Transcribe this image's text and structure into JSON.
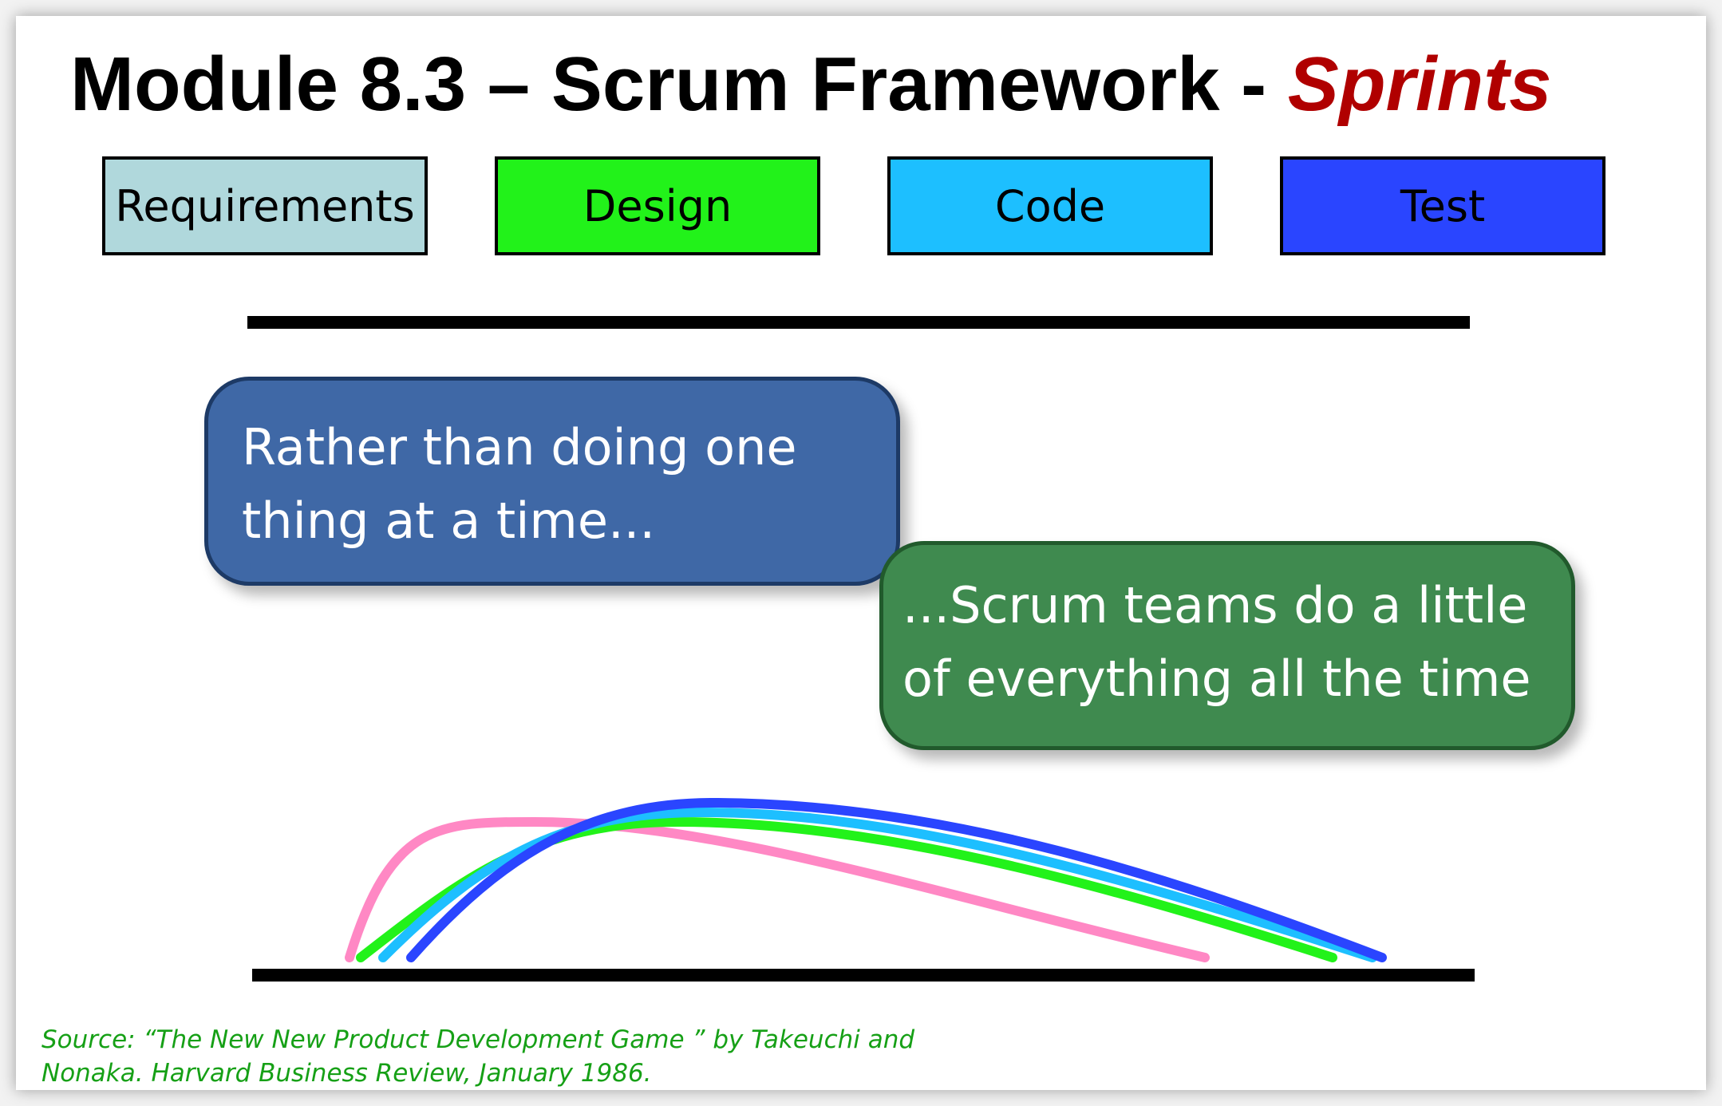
{
  "slide": {
    "title_main": "Module 8.3 – Scrum Framework - ",
    "title_accent": "Sprints"
  },
  "phases": [
    {
      "label": "Requirements",
      "color": "#b0d8dc"
    },
    {
      "label": "Design",
      "color": "#22f21a"
    },
    {
      "label": "Code",
      "color": "#1dbfff"
    },
    {
      "label": "Test",
      "color": "#2a45ff"
    }
  ],
  "callouts": {
    "first": {
      "line1": "Rather than doing one",
      "line2": "thing at a time..."
    },
    "second": {
      "line1": "...Scrum teams do a little",
      "line2": "of everything all the time"
    }
  },
  "curve_colors": {
    "requirements": "#ff88c4",
    "design": "#22f21a",
    "code": "#1dbfff",
    "test": "#2a45ff"
  },
  "source": {
    "line1": "Source:  “The New New Product Development Game ” by Takeuchi and",
    "line2": "Nonaka. Harvard Business Review, January 1986."
  }
}
